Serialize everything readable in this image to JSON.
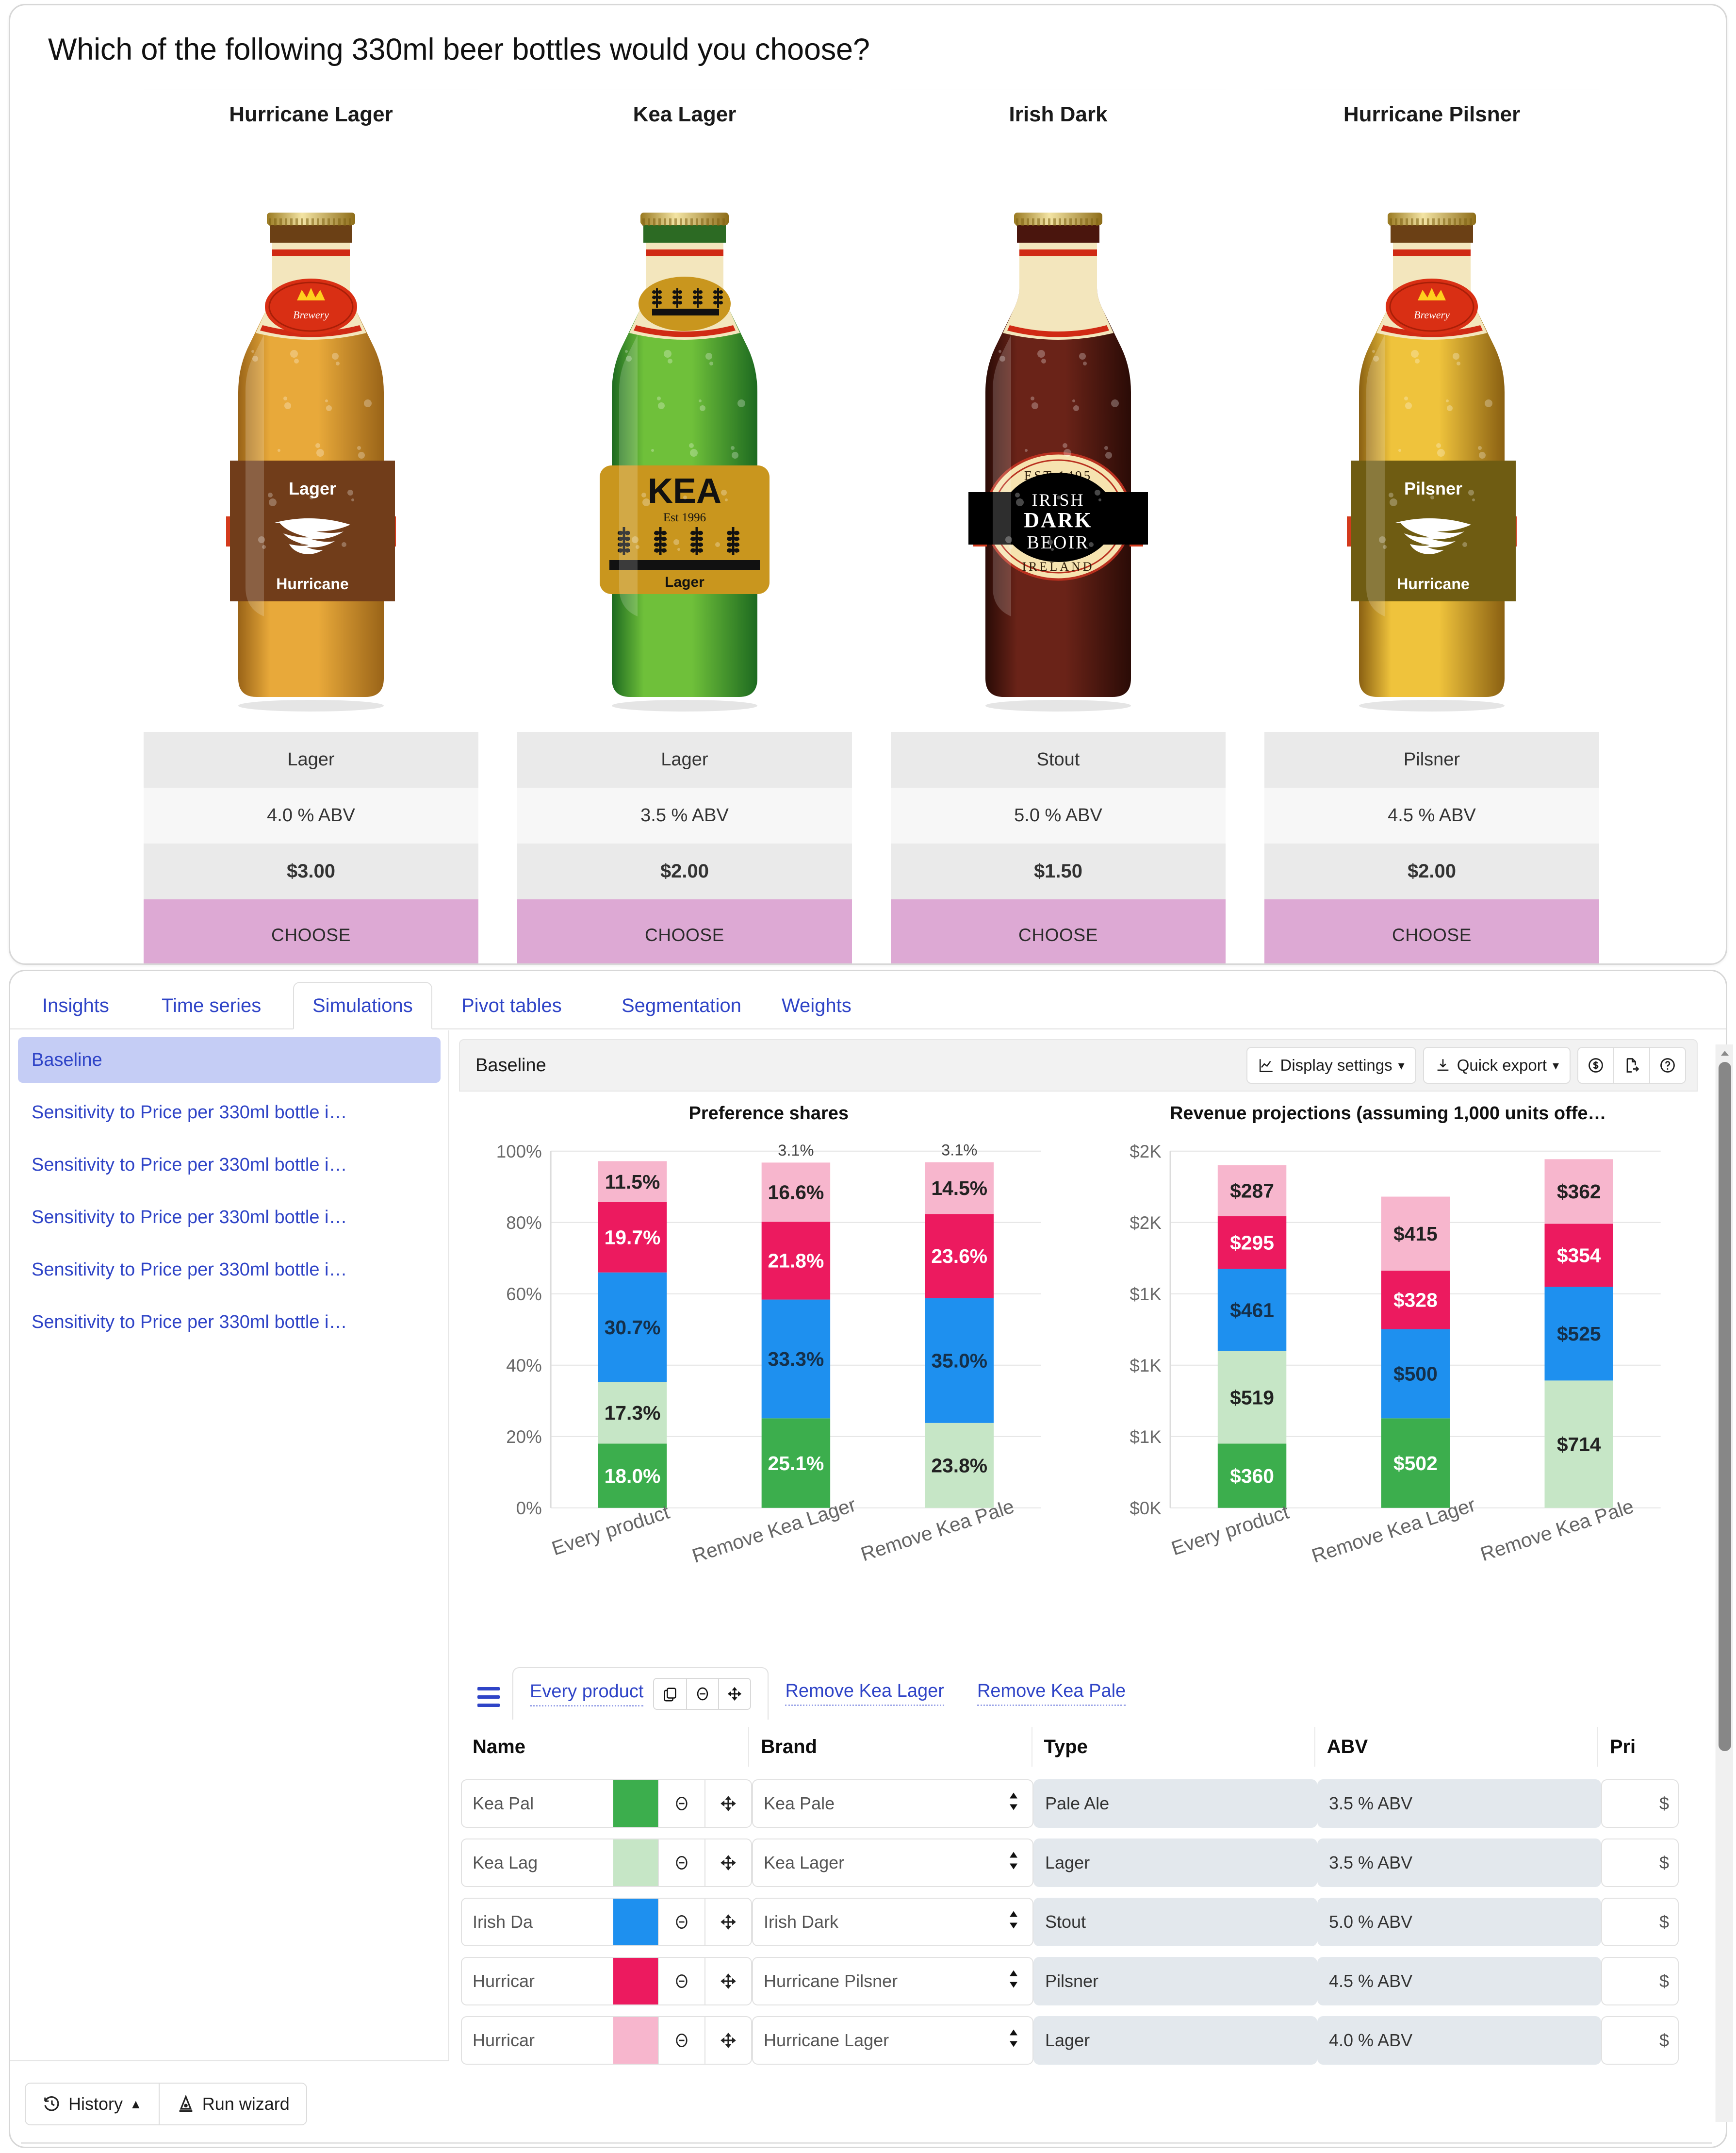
{
  "survey": {
    "question": "Which of the following 330ml beer bottles would you choose?",
    "products": [
      {
        "title": "Hurricane Lager",
        "type": "Lager",
        "abv": "4.0 % ABV",
        "price": "$3.00",
        "choose": "CHOOSE",
        "bottle": {
          "style": "amber",
          "label_top": "Lager",
          "label_bottom": "Hurricane",
          "logo": "tornado-icon",
          "neck_badge": "crown-icon"
        }
      },
      {
        "title": "Kea Lager",
        "type": "Lager",
        "abv": "3.5 % ABV",
        "price": "$2.00",
        "choose": "CHOOSE",
        "bottle": {
          "style": "green",
          "label_top": "KEA",
          "label_est": "Est 1996",
          "label_bottom": "Lager",
          "logo": "wheat-icon",
          "neck_badge": "wheat-icon"
        }
      },
      {
        "title": "Irish Dark",
        "type": "Stout",
        "abv": "5.0 % ABV",
        "price": "$1.50",
        "choose": "CHOOSE",
        "bottle": {
          "style": "dark",
          "label_est": "EST 1495",
          "label_l1": "IRISH",
          "label_l2": "DARK",
          "label_l3": "BEOIR",
          "label_country": "IRELAND"
        }
      },
      {
        "title": "Hurricane Pilsner",
        "type": "Pilsner",
        "abv": "4.5 % ABV",
        "price": "$2.00",
        "choose": "CHOOSE",
        "bottle": {
          "style": "gold",
          "label_top": "Pilsner",
          "label_bottom": "Hurricane",
          "logo": "tornado-icon",
          "neck_badge": "crown-icon"
        }
      }
    ]
  },
  "panel": {
    "tabs": [
      {
        "label": "Insights",
        "active": false
      },
      {
        "label": "Time series",
        "active": false
      },
      {
        "label": "Simulations",
        "active": true
      },
      {
        "label": "Pivot tables",
        "active": false
      },
      {
        "label": "Segmentation",
        "active": false
      },
      {
        "label": "Weights",
        "active": false
      }
    ],
    "sidebar": {
      "items": [
        {
          "label": "Baseline",
          "selected": true
        },
        {
          "label": "Sensitivity to Price per 330ml bottle i…",
          "selected": false
        },
        {
          "label": "Sensitivity to Price per 330ml bottle i…",
          "selected": false
        },
        {
          "label": "Sensitivity to Price per 330ml bottle i…",
          "selected": false
        },
        {
          "label": "Sensitivity to Price per 330ml bottle i…",
          "selected": false
        },
        {
          "label": "Sensitivity to Price per 330ml bottle i…",
          "selected": false
        }
      ],
      "footer": {
        "history": "History",
        "history_caret": "▲",
        "run_wizard": "Run wizard"
      }
    },
    "main_header": {
      "title": "Baseline",
      "display_settings": "Display settings",
      "quick_export": "Quick export",
      "caret": "▾"
    },
    "inner_tabs": [
      {
        "label": "Every product",
        "active": true
      },
      {
        "label": "Remove Kea Lager",
        "active": false
      },
      {
        "label": "Remove Kea Pale",
        "active": false
      }
    ],
    "table": {
      "columns": [
        "Name",
        "Brand",
        "Type",
        "ABV",
        "Pri"
      ],
      "rows": [
        {
          "name": "Kea Pal",
          "color": "#3cae4d",
          "brand": "Kea Pale",
          "type": "Pale Ale",
          "abv": "3.5 % ABV",
          "price": "$"
        },
        {
          "name": "Kea Laɡ",
          "color": "#c6e6c6",
          "brand": "Kea Lager",
          "type": "Lager",
          "abv": "3.5 % ABV",
          "price": "$"
        },
        {
          "name": "Irish Da",
          "color": "#1e90ef",
          "brand": "Irish Dark",
          "type": "Stout",
          "abv": "5.0 % ABV",
          "price": "$"
        },
        {
          "name": "Hurricar",
          "color": "#ec1a5f",
          "brand": "Hurricane Pilsner",
          "type": "Pilsner",
          "abv": "4.5 % ABV",
          "price": "$"
        },
        {
          "name": "Hurricar",
          "color": "#f7b6cd",
          "brand": "Hurricane Lager",
          "type": "Lager",
          "abv": "4.0 % ABV",
          "price": "$"
        }
      ]
    }
  },
  "chart_data": [
    {
      "type": "bar",
      "stacked": true,
      "title": "Preference shares",
      "categories": [
        "Every product",
        "Remove Kea Lager",
        "Remove Kea Pale"
      ],
      "series": [
        {
          "name": "Kea Pale",
          "color": "#3cae4d",
          "values": [
            18.0,
            25.1,
            null
          ],
          "labels": [
            "18.0%",
            "25.1%",
            null
          ]
        },
        {
          "name": "Kea Lager",
          "color": "#c6e6c6",
          "values": [
            17.3,
            null,
            23.8
          ],
          "labels": [
            "17.3%",
            null,
            "23.8%"
          ]
        },
        {
          "name": "Irish Dark",
          "color": "#1e90ef",
          "values": [
            30.7,
            33.3,
            35.0
          ],
          "labels": [
            "30.7%",
            "33.3%",
            "35.0%"
          ]
        },
        {
          "name": "Hurricane Pilsner",
          "color": "#ec1a5f",
          "values": [
            19.7,
            21.8,
            23.6
          ],
          "labels": [
            "19.7%",
            "21.8%",
            "23.6%"
          ]
        },
        {
          "name": "Hurricane Lager",
          "color": "#f7b6cd",
          "values": [
            11.5,
            16.6,
            14.5
          ],
          "labels": [
            "11.5%",
            "16.6%",
            "14.5%"
          ]
        }
      ],
      "top_annotations": [
        null,
        "3.1%",
        "3.1%"
      ],
      "ylabel": "",
      "xlabel": "",
      "ylim": [
        0,
        100
      ],
      "yticks": [
        "0%",
        "20%",
        "40%",
        "60%",
        "80%",
        "100%"
      ],
      "grid": true,
      "legend": "none"
    },
    {
      "type": "bar",
      "stacked": true,
      "title": "Revenue projections (assuming 1,000 units offe…",
      "categories": [
        "Every product",
        "Remove Kea Lager",
        "Remove Kea Pale"
      ],
      "series": [
        {
          "name": "Kea Pale",
          "color": "#3cae4d",
          "values": [
            360,
            502,
            null
          ],
          "labels": [
            "$360",
            "$502",
            null
          ]
        },
        {
          "name": "Kea Lager",
          "color": "#c6e6c6",
          "values": [
            519,
            null,
            714
          ],
          "labels": [
            "$519",
            null,
            "$714"
          ]
        },
        {
          "name": "Irish Dark",
          "color": "#1e90ef",
          "values": [
            461,
            500,
            525
          ],
          "labels": [
            "$461",
            "$500",
            "$525"
          ]
        },
        {
          "name": "Hurricane Pilsner",
          "color": "#ec1a5f",
          "values": [
            295,
            328,
            354
          ],
          "labels": [
            "$295",
            "$328",
            "$354"
          ]
        },
        {
          "name": "Hurricane Lager",
          "color": "#f7b6cd",
          "values": [
            287,
            415,
            362
          ],
          "labels": [
            "$287",
            "$415",
            "$362"
          ]
        }
      ],
      "ylabel": "",
      "xlabel": "",
      "ylim": [
        0,
        2000
      ],
      "yticks": [
        "$0K",
        "$1K",
        "$1K",
        "$1K",
        "$2K",
        "$2K"
      ],
      "grid": true,
      "legend": "none"
    }
  ]
}
